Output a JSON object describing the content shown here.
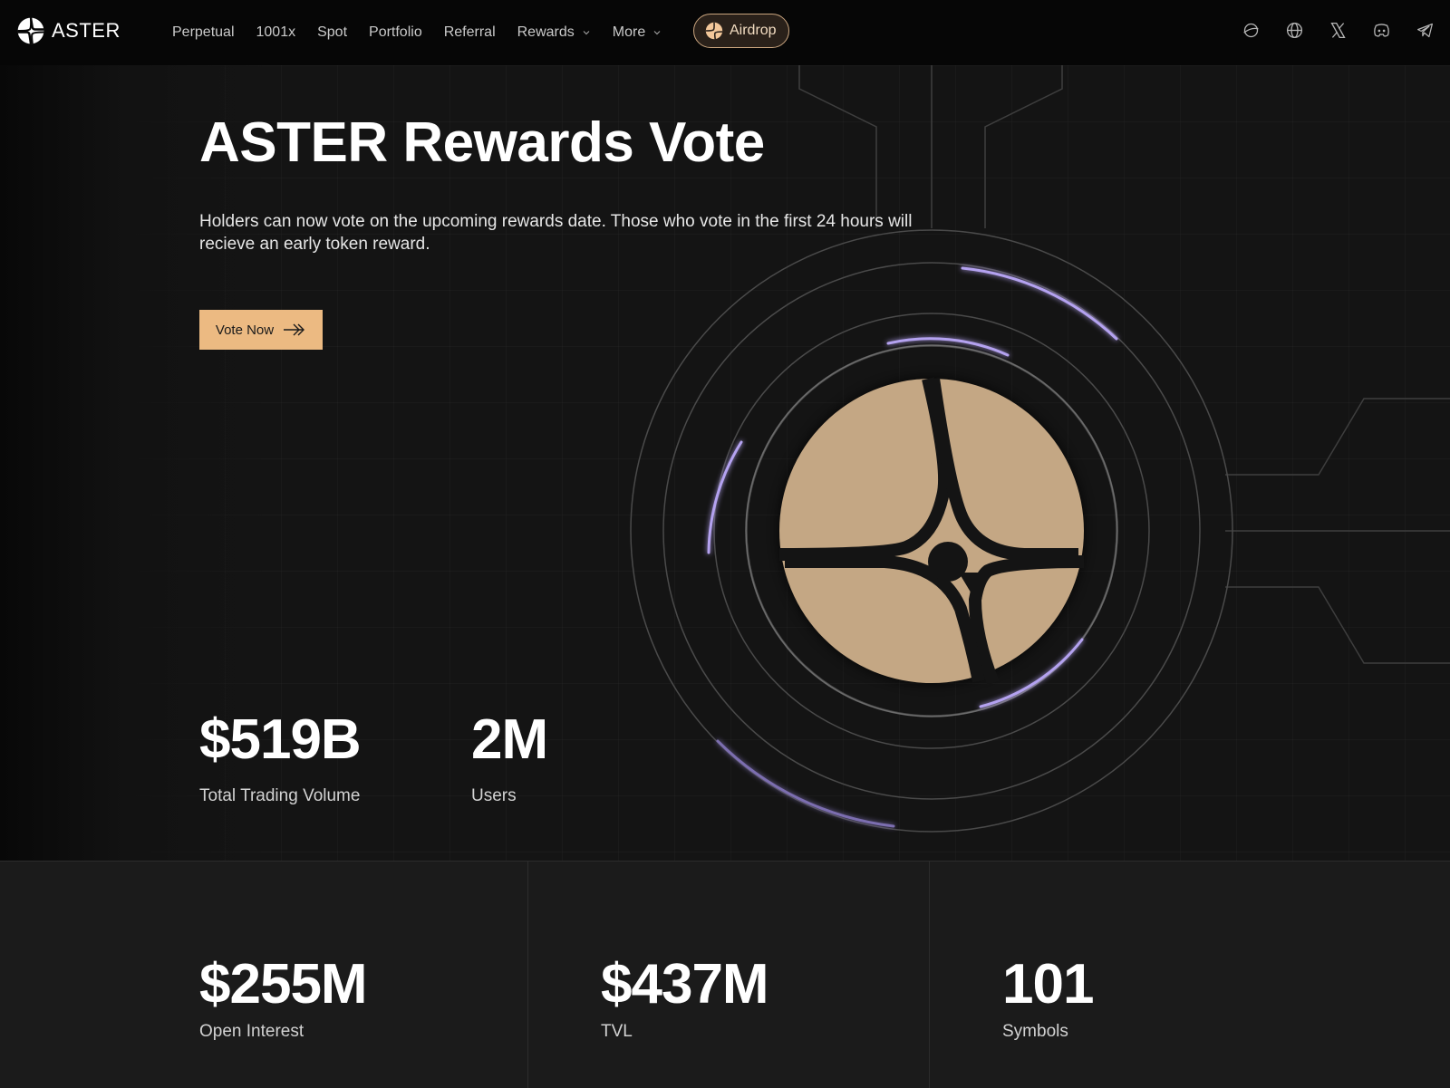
{
  "brand": {
    "name": "ASTER"
  },
  "nav": {
    "items": [
      {
        "label": "Perpetual"
      },
      {
        "label": "1001x"
      },
      {
        "label": "Spot"
      },
      {
        "label": "Portfolio"
      },
      {
        "label": "Referral"
      },
      {
        "label": "Rewards",
        "has_dropdown": true
      },
      {
        "label": "More",
        "has_dropdown": true
      }
    ],
    "airdrop_label": "Airdrop"
  },
  "social_icons": [
    "orbit-icon",
    "globe-icon",
    "x-icon",
    "discord-icon",
    "telegram-icon"
  ],
  "hero": {
    "title": "ASTER Rewards Vote",
    "description": "Holders can now vote on the upcoming rewards date. Those who vote in the first 24 hours will recieve an early token reward.",
    "cta_label": "Vote Now"
  },
  "stats": [
    {
      "value": "$519B",
      "label": "Total Trading Volume"
    },
    {
      "value": "2M",
      "label": "Users"
    }
  ],
  "metrics": [
    {
      "value": "$255M",
      "label": "Open Interest"
    },
    {
      "value": "$437M",
      "label": "TVL"
    },
    {
      "value": "101",
      "label": "Symbols"
    }
  ],
  "colors": {
    "accent": "#ecba82",
    "logo_fill": "#c4a784",
    "glow": "#b4a2f0",
    "background": "#1b1b1b"
  }
}
